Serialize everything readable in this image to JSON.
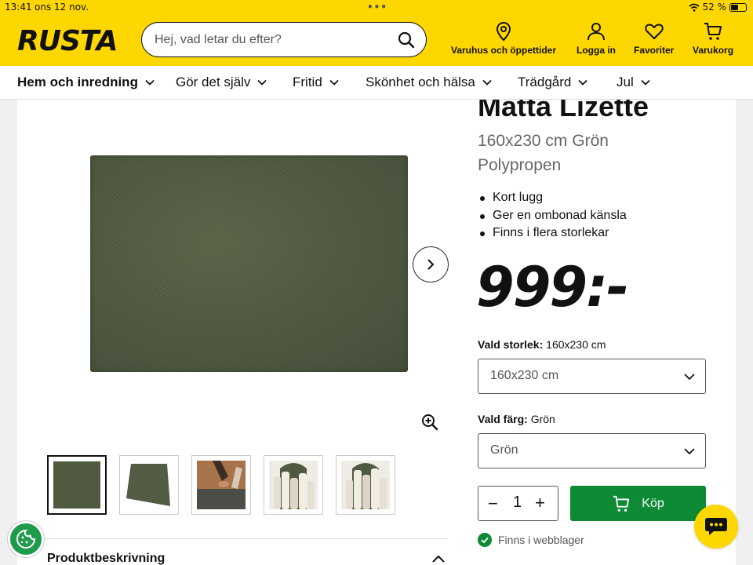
{
  "status_bar": {
    "time": "13:41",
    "date": "ons 12 nov.",
    "dots": "•••",
    "battery": "52 %",
    "battery_level": 0.52
  },
  "header": {
    "logo": "RUSTA",
    "search_placeholder": "Hej, vad letar du efter?",
    "nav": [
      {
        "label": "Varuhus och öppettider",
        "icon": "location-pin-icon"
      },
      {
        "label": "Logga in",
        "icon": "user-icon"
      },
      {
        "label": "Favoriter",
        "icon": "heart-icon"
      },
      {
        "label": "Varukorg",
        "icon": "cart-icon"
      }
    ]
  },
  "categories": [
    {
      "label": "Hem och inredning",
      "active": true
    },
    {
      "label": "Gör det själv",
      "active": false
    },
    {
      "label": "Fritid",
      "active": false
    },
    {
      "label": "Skönhet och hälsa",
      "active": false
    },
    {
      "label": "Trädgård",
      "active": false
    },
    {
      "label": "Jul",
      "active": false
    }
  ],
  "product": {
    "title": "Matta Lizette",
    "subtitle_line1": "160x230 cm Grön",
    "subtitle_line2": "Polypropen",
    "features": [
      "Kort lugg",
      "Ger en ombonad känsla",
      "Finns i flera storlekar"
    ],
    "price": "999:-",
    "size_label": "Vald storlek:",
    "size_value": "160x230 cm",
    "size_select": "160x230 cm",
    "color_label": "Vald färg:",
    "color_value": "Grön",
    "color_select": "Grön",
    "quantity": "1",
    "buy_label": "Köp",
    "stock_status": "Finns i webblager",
    "description_heading": "Produktbeskrivning",
    "thumbnail_count": 5
  },
  "colors": {
    "brand_yellow": "#ffd700",
    "buy_green": "#0c8a34",
    "rug_green": "#4f5a40"
  }
}
